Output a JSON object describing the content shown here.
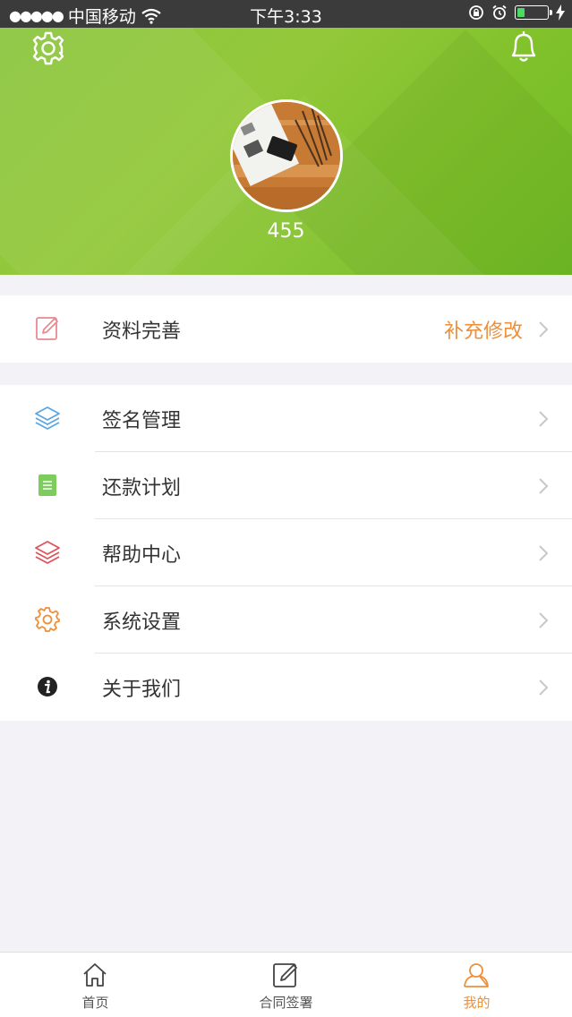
{
  "status_bar": {
    "signal_dots": "●●●●●",
    "carrier": "中国移动",
    "time": "下午3:33",
    "battery_level": 0.25
  },
  "header": {
    "settings_icon": "gear-icon",
    "notifications_icon": "bell-icon",
    "username": "455"
  },
  "profile_row": {
    "icon": "edit-icon",
    "label": "资料完善",
    "action": "补充修改"
  },
  "menu": {
    "items": [
      {
        "icon": "layers-icon",
        "label": "签名管理",
        "color": "#5aa6e0"
      },
      {
        "icon": "document-icon",
        "label": "还款计划",
        "color": "#7ccd5b"
      },
      {
        "icon": "layers-icon",
        "label": "帮助中心",
        "color": "#e0525a"
      },
      {
        "icon": "gear-icon",
        "label": "系统设置",
        "color": "#ee8f3a"
      },
      {
        "icon": "info-icon",
        "label": "关于我们",
        "color": "#222222"
      }
    ]
  },
  "tab_bar": {
    "tabs": [
      {
        "icon": "home-icon",
        "label": "首页",
        "active": false
      },
      {
        "icon": "sign-icon",
        "label": "合同签署",
        "active": false
      },
      {
        "icon": "person-icon",
        "label": "我的",
        "active": true
      }
    ]
  },
  "colors": {
    "header_green": "#8cc63f",
    "accent_orange": "#ee8f3a",
    "background": "#f3f2f7"
  }
}
